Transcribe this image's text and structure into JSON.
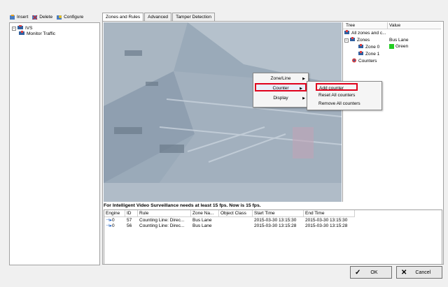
{
  "toolbar": {
    "insert": "Insert",
    "delete": "Delete",
    "configure": "Configure"
  },
  "left_tree": {
    "root": "IVS",
    "child": "Monitor Traffic"
  },
  "tabs": [
    "Zones and Rules",
    "Advanced",
    "Tamper Detection"
  ],
  "props": {
    "header_tree": "Tree",
    "header_value": "Value",
    "rows": [
      {
        "label": "All zones and c...",
        "value": ""
      },
      {
        "label": "Zones",
        "value": "Bus Lane"
      },
      {
        "label": "Zone 0",
        "value": "Green"
      },
      {
        "label": "Zone 1",
        "value": ""
      },
      {
        "label": "Counters",
        "value": ""
      }
    ],
    "green": "#22cc22"
  },
  "context_menu": {
    "items": [
      "Zone/Line",
      "Counter",
      "Display"
    ]
  },
  "submenu": {
    "items": [
      "Add counter",
      "Reset All counters",
      "Remove All counters"
    ]
  },
  "warning": "For Intelligent Video Surveillance needs at least 15 fps. Now is 15 fps.",
  "grid": {
    "columns": [
      "Engine",
      "ID",
      "Rule",
      "Zone Na...",
      "Object Class",
      "Start Time",
      "End Time"
    ],
    "rows": [
      [
        "0",
        "57",
        "Counting Line: Direc...",
        "Bus Lane",
        "",
        "2015-03-30 13:15:30",
        "2015-03-30 13:15:30"
      ],
      [
        "0",
        "56",
        "Counting Line: Direc...",
        "Bus Lane",
        "",
        "2015-03-30 13:15:28",
        "2015-03-30 13:15:28"
      ]
    ]
  },
  "buttons": {
    "ok": "OK",
    "cancel": "Cancel"
  },
  "colors": {
    "highlight": "#e0001b",
    "video_tint": "#9aa9b8"
  }
}
